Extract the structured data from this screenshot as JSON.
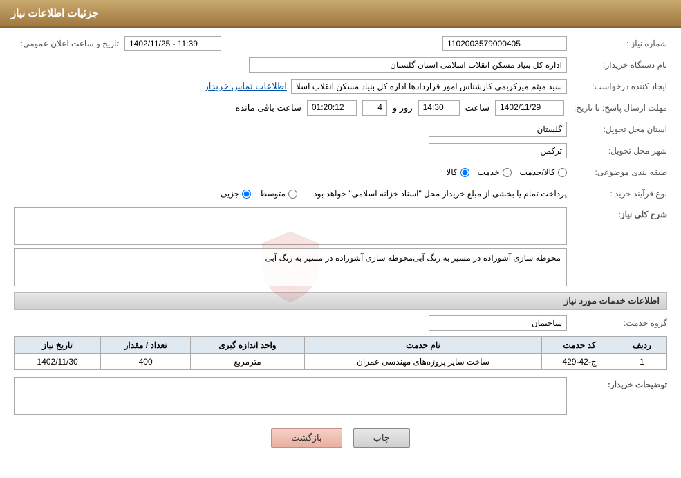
{
  "header": {
    "title": "جزئیات اطلاعات نیاز"
  },
  "fields": {
    "need_number_label": "شماره نیاز :",
    "need_number_value": "1102003579000405",
    "announce_label": "تاریخ و ساعت اعلان عمومی:",
    "announce_value": "1402/11/25 - 11:39",
    "org_name_label": "نام دستگاه خریدار:",
    "org_name_value": "اداره کل بنیاد مسکن انقلاب اسلامی استان گلستان",
    "creator_label": "ایجاد کننده درخواست:",
    "creator_value": "سید میثم میرکریمی کارشناس امور قراردادها اداره کل بنیاد مسکن انقلاب اسلا",
    "creator_link": "اطلاعات تماس خریدار",
    "deadline_label": "مهلت ارسال پاسخ: تا تاریخ:",
    "deadline_date": "1402/11/29",
    "deadline_time_label": "ساعت",
    "deadline_time": "14:30",
    "deadline_day_label": "روز و",
    "deadline_days": "4",
    "deadline_remain_label": "ساعت باقی مانده",
    "deadline_remain": "01:20:12",
    "province_label": "استان محل تحویل:",
    "province_value": "گلستان",
    "city_label": "شهر محل تحویل:",
    "city_value": "ترکمن",
    "category_label": "طبقه بندی موضوعی:",
    "category_options": [
      {
        "label": "کالا",
        "value": "kala"
      },
      {
        "label": "خدمت",
        "value": "khadamat"
      },
      {
        "label": "کالا/خدمت",
        "value": "kala_khadamat"
      }
    ],
    "category_selected": "kala",
    "process_label": "نوع فرآیند خرید :",
    "process_options": [
      {
        "label": "جزیی",
        "value": "jozi"
      },
      {
        "label": "متوسط",
        "value": "motavasset"
      }
    ],
    "process_desc": "پرداخت تمام یا بخشی از مبلغ خریداز محل \"اسناد خزانه اسلامی\" خواهد بود.",
    "process_selected": "jozi",
    "general_desc_label": "شرح کلی نیاز:",
    "general_desc_value": "محوطه سازی آشوراده در مسیر به رنگ آبی",
    "services_section": "اطلاعات خدمات مورد نیاز",
    "service_group_label": "گروه حدمت:",
    "service_group_value": "ساختمان",
    "table_headers": [
      "ردیف",
      "کد حدمت",
      "نام حدمت",
      "واحد اندازه گیری",
      "تعداد / مقدار",
      "تاریخ نیاز"
    ],
    "table_rows": [
      {
        "row": "1",
        "code": "ج-42-429",
        "name": "ساخت سایر پروژه‌های مهندسی عمران",
        "unit": "مترمربع",
        "quantity": "400",
        "date": "1402/11/30"
      }
    ],
    "buyer_desc_label": "توضیحات خریدار:",
    "buyer_desc_value": "",
    "btn_back": "بازگشت",
    "btn_print": "چاپ"
  }
}
